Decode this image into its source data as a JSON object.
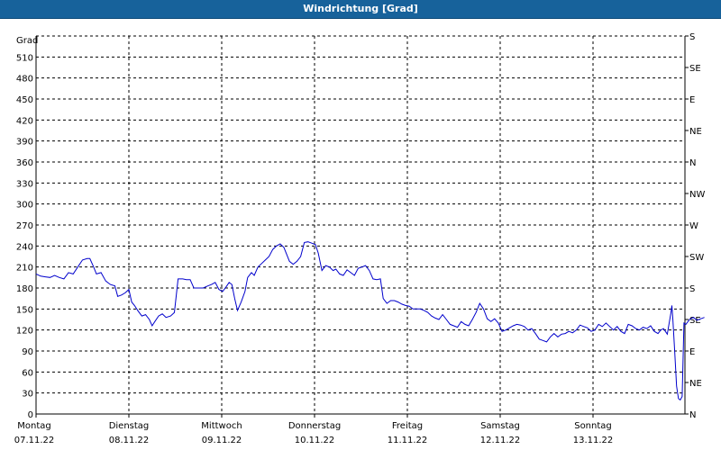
{
  "window": {
    "title": "Windrichtung [Grad]"
  },
  "chart_data": {
    "type": "line",
    "title": "Windrichtung [Grad]",
    "ylabel": "Grad",
    "ylim": [
      0,
      540
    ],
    "yticks": [
      0,
      30,
      60,
      90,
      120,
      150,
      180,
      210,
      240,
      270,
      300,
      330,
      360,
      390,
      420,
      450,
      480,
      510
    ],
    "right_axis_labels": [
      {
        "label": "N",
        "value": 0
      },
      {
        "label": "NE",
        "value": 45
      },
      {
        "label": "E",
        "value": 90
      },
      {
        "label": "SE",
        "value": 135
      },
      {
        "label": "S",
        "value": 180
      },
      {
        "label": "SW",
        "value": 225
      },
      {
        "label": "W",
        "value": 270
      },
      {
        "label": "NW",
        "value": 315
      },
      {
        "label": "N",
        "value": 360
      },
      {
        "label": "NE",
        "value": 405
      },
      {
        "label": "E",
        "value": 450
      },
      {
        "label": "SE",
        "value": 495
      },
      {
        "label": "S",
        "value": 540
      }
    ],
    "xlim_days": [
      0,
      7
    ],
    "days": [
      {
        "day": "Montag",
        "date": "07.11.22"
      },
      {
        "day": "Dienstag",
        "date": "08.11.22"
      },
      {
        "day": "Mittwoch",
        "date": "09.11.22"
      },
      {
        "day": "Donnerstag",
        "date": "10.11.22"
      },
      {
        "day": "Freitag",
        "date": "11.11.22"
      },
      {
        "day": "Samstag",
        "date": "12.11.22"
      },
      {
        "day": "Sonntag",
        "date": "13.11.22"
      }
    ],
    "grid": true,
    "series": [
      {
        "color": "#0000cc",
        "points": [
          [
            0.0,
            200
          ],
          [
            0.05,
            197
          ],
          [
            0.1,
            196
          ],
          [
            0.15,
            195
          ],
          [
            0.2,
            198
          ],
          [
            0.25,
            195
          ],
          [
            0.3,
            193
          ],
          [
            0.35,
            202
          ],
          [
            0.4,
            200
          ],
          [
            0.45,
            210
          ],
          [
            0.5,
            220
          ],
          [
            0.55,
            222
          ],
          [
            0.58,
            222
          ],
          [
            0.62,
            210
          ],
          [
            0.65,
            200
          ],
          [
            0.7,
            202
          ],
          [
            0.75,
            190
          ],
          [
            0.8,
            185
          ],
          [
            0.85,
            183
          ],
          [
            0.88,
            168
          ],
          [
            0.92,
            170
          ],
          [
            0.96,
            173
          ],
          [
            1.0,
            178
          ],
          [
            1.03,
            160
          ],
          [
            1.06,
            155
          ],
          [
            1.1,
            147
          ],
          [
            1.14,
            140
          ],
          [
            1.18,
            142
          ],
          [
            1.22,
            135
          ],
          [
            1.25,
            126
          ],
          [
            1.28,
            132
          ],
          [
            1.32,
            140
          ],
          [
            1.36,
            143
          ],
          [
            1.4,
            138
          ],
          [
            1.45,
            140
          ],
          [
            1.49,
            145
          ],
          [
            1.53,
            193
          ],
          [
            1.58,
            193
          ],
          [
            1.62,
            192
          ],
          [
            1.66,
            192
          ],
          [
            1.7,
            180
          ],
          [
            1.75,
            180
          ],
          [
            1.8,
            180
          ],
          [
            1.85,
            183
          ],
          [
            1.89,
            185
          ],
          [
            1.93,
            188
          ],
          [
            1.97,
            178
          ],
          [
            2.01,
            175
          ],
          [
            2.05,
            182
          ],
          [
            2.08,
            188
          ],
          [
            2.11,
            185
          ],
          [
            2.14,
            165
          ],
          [
            2.17,
            148
          ],
          [
            2.21,
            160
          ],
          [
            2.25,
            175
          ],
          [
            2.28,
            195
          ],
          [
            2.32,
            202
          ],
          [
            2.35,
            198
          ],
          [
            2.39,
            210
          ],
          [
            2.43,
            215
          ],
          [
            2.47,
            220
          ],
          [
            2.51,
            225
          ],
          [
            2.55,
            235
          ],
          [
            2.59,
            240
          ],
          [
            2.63,
            243
          ],
          [
            2.67,
            238
          ],
          [
            2.7,
            228
          ],
          [
            2.73,
            218
          ],
          [
            2.77,
            214
          ],
          [
            2.81,
            218
          ],
          [
            2.85,
            225
          ],
          [
            2.89,
            245
          ],
          [
            2.93,
            246
          ],
          [
            2.97,
            244
          ],
          [
            3.01,
            242
          ],
          [
            3.04,
            230
          ],
          [
            3.08,
            205
          ],
          [
            3.12,
            212
          ],
          [
            3.16,
            210
          ],
          [
            3.2,
            205
          ],
          [
            3.23,
            207
          ],
          [
            3.27,
            200
          ],
          [
            3.31,
            198
          ],
          [
            3.35,
            206
          ],
          [
            3.39,
            202
          ],
          [
            3.43,
            198
          ],
          [
            3.47,
            208
          ],
          [
            3.51,
            210
          ],
          [
            3.55,
            212
          ],
          [
            3.59,
            205
          ],
          [
            3.63,
            193
          ],
          [
            3.67,
            192
          ],
          [
            3.71,
            193
          ],
          [
            3.74,
            165
          ],
          [
            3.78,
            158
          ],
          [
            3.82,
            162
          ],
          [
            3.86,
            162
          ],
          [
            3.9,
            160
          ],
          [
            3.94,
            157
          ],
          [
            3.98,
            155
          ],
          [
            4.02,
            154
          ],
          [
            4.06,
            150
          ],
          [
            4.1,
            150
          ],
          [
            4.14,
            150
          ],
          [
            4.18,
            148
          ],
          [
            4.22,
            145
          ],
          [
            4.26,
            140
          ],
          [
            4.3,
            137
          ],
          [
            4.34,
            135
          ],
          [
            4.38,
            142
          ],
          [
            4.42,
            135
          ],
          [
            4.46,
            128
          ],
          [
            4.5,
            126
          ],
          [
            4.54,
            124
          ],
          [
            4.58,
            132
          ],
          [
            4.62,
            128
          ],
          [
            4.66,
            126
          ],
          [
            4.7,
            135
          ],
          [
            4.74,
            145
          ],
          [
            4.78,
            158
          ],
          [
            4.82,
            150
          ],
          [
            4.86,
            136
          ],
          [
            4.9,
            132
          ],
          [
            4.94,
            136
          ],
          [
            4.98,
            130
          ],
          [
            5.02,
            118
          ],
          [
            5.06,
            120
          ],
          [
            5.1,
            123
          ],
          [
            5.14,
            126
          ],
          [
            5.18,
            128
          ],
          [
            5.22,
            127
          ],
          [
            5.26,
            125
          ],
          [
            5.3,
            120
          ],
          [
            5.34,
            122
          ],
          [
            5.38,
            115
          ],
          [
            5.42,
            107
          ],
          [
            5.46,
            105
          ],
          [
            5.5,
            103
          ],
          [
            5.54,
            110
          ],
          [
            5.58,
            115
          ],
          [
            5.62,
            110
          ],
          [
            5.66,
            114
          ],
          [
            5.7,
            115
          ],
          [
            5.74,
            118
          ],
          [
            5.78,
            116
          ],
          [
            5.82,
            120
          ],
          [
            5.86,
            127
          ],
          [
            5.9,
            125
          ],
          [
            5.94,
            123
          ],
          [
            5.98,
            118
          ],
          [
            6.02,
            120
          ],
          [
            6.06,
            128
          ],
          [
            6.1,
            125
          ],
          [
            6.14,
            130
          ],
          [
            6.18,
            125
          ],
          [
            6.22,
            120
          ],
          [
            6.26,
            125
          ],
          [
            6.3,
            118
          ],
          [
            6.34,
            115
          ],
          [
            6.38,
            128
          ],
          [
            6.42,
            126
          ],
          [
            6.46,
            122
          ],
          [
            6.5,
            120
          ],
          [
            6.54,
            124
          ],
          [
            6.58,
            122
          ],
          [
            6.62,
            126
          ],
          [
            6.66,
            118
          ],
          [
            6.7,
            115
          ],
          [
            6.73,
            120
          ],
          [
            6.76,
            122
          ],
          [
            6.78,
            118
          ],
          [
            6.8,
            114
          ],
          [
            6.82,
            130
          ],
          [
            6.84,
            145
          ],
          [
            6.85,
            155
          ],
          [
            6.86,
            135
          ],
          [
            6.88,
            90
          ],
          [
            6.9,
            40
          ],
          [
            6.92,
            22
          ],
          [
            6.94,
            20
          ],
          [
            6.96,
            25
          ],
          [
            6.98,
            130
          ],
          [
            7.0,
            128
          ],
          [
            7.04,
            135
          ],
          [
            7.08,
            138
          ],
          [
            7.12,
            134
          ],
          [
            7.16,
            136
          ],
          [
            7.2,
            138
          ]
        ]
      }
    ]
  }
}
